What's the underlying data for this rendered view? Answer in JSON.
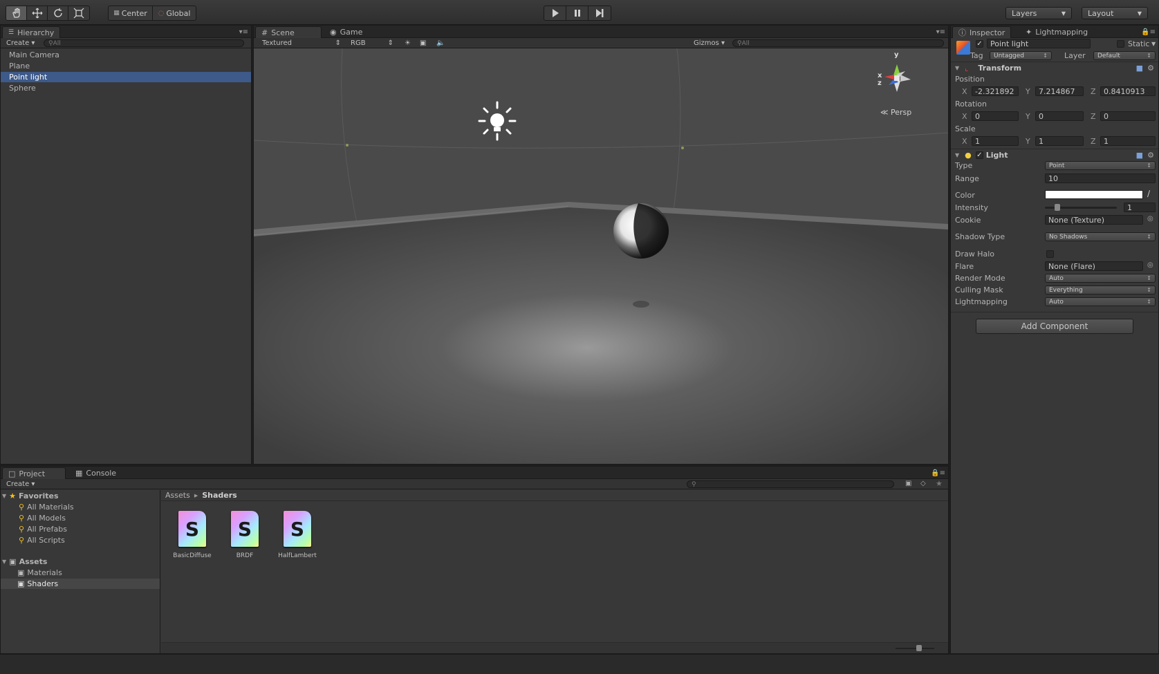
{
  "toolbar": {
    "tools": [
      "hand-tool-icon",
      "move-tool-icon",
      "rotate-tool-icon",
      "scale-tool-icon"
    ],
    "pivot": "Center",
    "space": "Global",
    "layers": "Layers",
    "layout": "Layout"
  },
  "hierarchy": {
    "tab": "Hierarchy",
    "create": "Create",
    "search_placeholder": "All",
    "items": [
      "Main Camera",
      "Plane",
      "Point light",
      "Sphere"
    ],
    "selected": "Point light"
  },
  "scene": {
    "tabs": [
      "Scene",
      "Game"
    ],
    "render_mode": "Textured",
    "channel": "RGB",
    "gizmos": "Gizmos",
    "search_placeholder": "All",
    "projection": "Persp",
    "gizmo_axes": {
      "y": "y",
      "x": "x",
      "z": "z"
    }
  },
  "inspector": {
    "tabs": [
      "Inspector",
      "Lightmapping"
    ],
    "object_name": "Point light",
    "static_label": "Static",
    "tag_label": "Tag",
    "tag_value": "Untagged",
    "layer_label": "Layer",
    "layer_value": "Default",
    "transform": {
      "title": "Transform",
      "position_label": "Position",
      "position": {
        "x": "-2.321892",
        "y": "7.214867",
        "z": "0.8410913"
      },
      "rotation_label": "Rotation",
      "rotation": {
        "x": "0",
        "y": "0",
        "z": "0"
      },
      "scale_label": "Scale",
      "scale": {
        "x": "1",
        "y": "1",
        "z": "1"
      },
      "axis_x": "X",
      "axis_y": "Y",
      "axis_z": "Z"
    },
    "light": {
      "title": "Light",
      "type_label": "Type",
      "type_value": "Point",
      "range_label": "Range",
      "range_value": "10",
      "color_label": "Color",
      "color_value": "#ffffff",
      "intensity_label": "Intensity",
      "intensity_value": "1",
      "intensity_fraction": 0.15,
      "cookie_label": "Cookie",
      "cookie_value": "None (Texture)",
      "shadow_label": "Shadow Type",
      "shadow_value": "No Shadows",
      "halo_label": "Draw Halo",
      "flare_label": "Flare",
      "flare_value": "None (Flare)",
      "render_label": "Render Mode",
      "render_value": "Auto",
      "culling_label": "Culling Mask",
      "culling_value": "Everything",
      "lightmapping_label": "Lightmapping",
      "lightmapping_value": "Auto"
    },
    "add_component": "Add Component"
  },
  "project": {
    "tabs": [
      "Project",
      "Console"
    ],
    "create": "Create",
    "favorites_label": "Favorites",
    "favorites": [
      "All Materials",
      "All Models",
      "All Prefabs",
      "All Scripts"
    ],
    "assets_label": "Assets",
    "folders": [
      "Materials",
      "Shaders"
    ],
    "selected_folder": "Shaders",
    "breadcrumb": [
      "Assets",
      "Shaders"
    ],
    "files": [
      "BasicDiffuse",
      "BRDF",
      "HalfLambert"
    ]
  },
  "colors": {
    "selection": "#3d5a8a",
    "panel": "#383838",
    "scene_bg": "#4c4c4c"
  }
}
